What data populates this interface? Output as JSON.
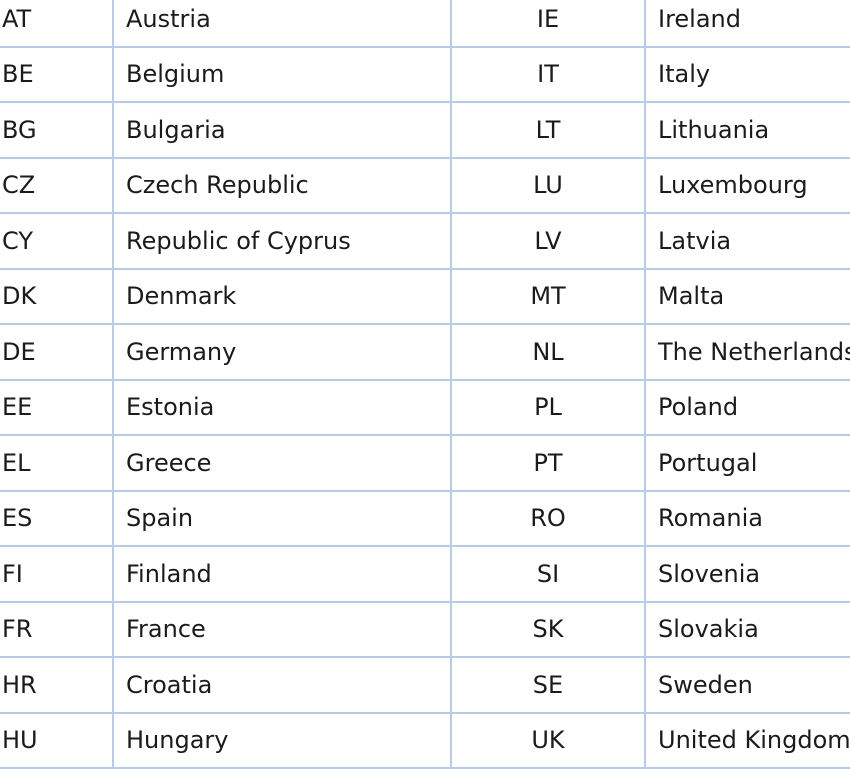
{
  "rows": [
    {
      "code1": "AT",
      "name1": "Austria",
      "code2": "IE",
      "name2": "Ireland"
    },
    {
      "code1": "BE",
      "name1": "Belgium",
      "code2": "IT",
      "name2": "Italy"
    },
    {
      "code1": "BG",
      "name1": "Bulgaria",
      "code2": "LT",
      "name2": "Lithuania"
    },
    {
      "code1": "CZ",
      "name1": "Czech Republic",
      "code2": "LU",
      "name2": "Luxembourg"
    },
    {
      "code1": "CY",
      "name1": "Republic of Cyprus",
      "code2": "LV",
      "name2": "Latvia"
    },
    {
      "code1": "DK",
      "name1": "Denmark",
      "code2": "MT",
      "name2": "Malta"
    },
    {
      "code1": "DE",
      "name1": "Germany",
      "code2": "NL",
      "name2": "The Netherlands"
    },
    {
      "code1": "EE",
      "name1": "Estonia",
      "code2": "PL",
      "name2": "Poland"
    },
    {
      "code1": "EL",
      "name1": "Greece",
      "code2": "PT",
      "name2": "Portugal"
    },
    {
      "code1": "ES",
      "name1": "Spain",
      "code2": "RO",
      "name2": "Romania"
    },
    {
      "code1": "FI",
      "name1": "Finland",
      "code2": "SI",
      "name2": "Slovenia"
    },
    {
      "code1": "FR",
      "name1": "France",
      "code2": "SK",
      "name2": "Slovakia"
    },
    {
      "code1": "HR",
      "name1": "Croatia",
      "code2": "SE",
      "name2": "Sweden"
    },
    {
      "code1": "HU",
      "name1": "Hungary",
      "code2": "UK",
      "name2": "United Kingdom"
    }
  ]
}
